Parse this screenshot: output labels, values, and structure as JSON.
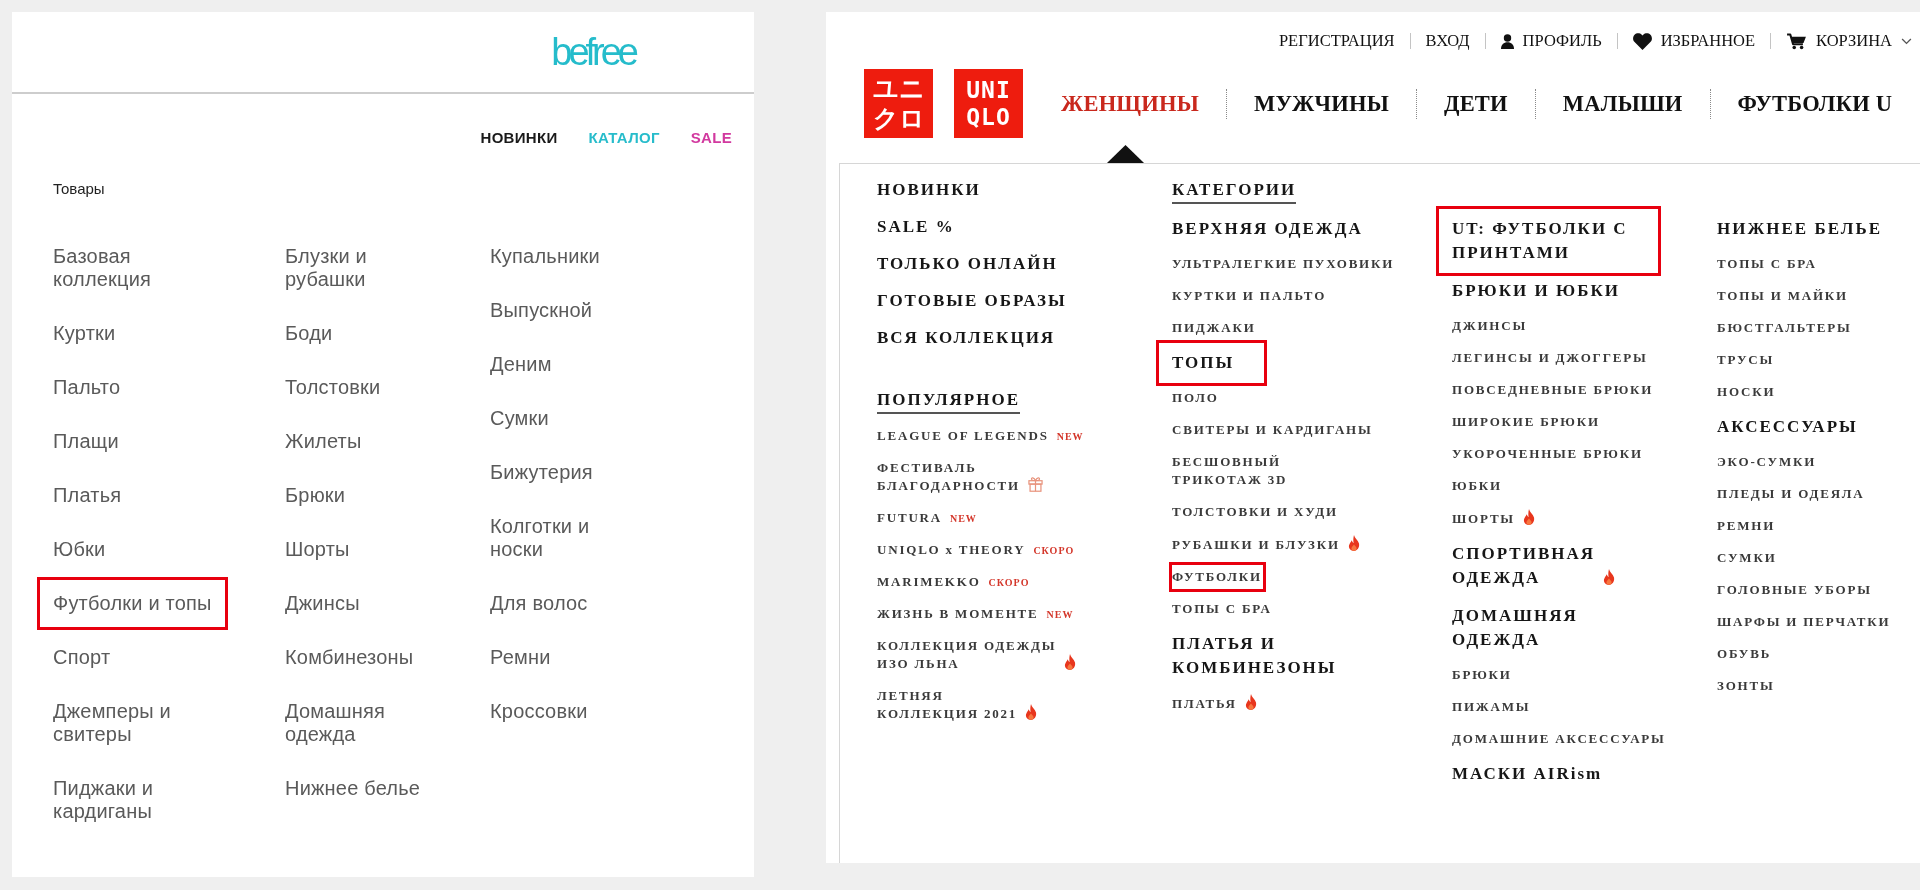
{
  "befree": {
    "logo": "befree",
    "nav": [
      {
        "label": "НОВИНКИ",
        "color": "#1a1a1a"
      },
      {
        "label": "КАТАЛОГ",
        "color": "#27bccb"
      },
      {
        "label": "SALE",
        "color": "#d2399f"
      }
    ],
    "section_title": "Товары",
    "columns": [
      [
        {
          "label": "Базовая\nколлекция",
          "highlighted": false
        },
        {
          "label": "Куртки",
          "highlighted": false
        },
        {
          "label": "Пальто",
          "highlighted": false
        },
        {
          "label": "Плащи",
          "highlighted": false
        },
        {
          "label": "Платья",
          "highlighted": false
        },
        {
          "label": "Юбки",
          "highlighted": false
        },
        {
          "label": "Футболки и топы",
          "highlighted": true
        },
        {
          "label": "Спорт",
          "highlighted": false
        },
        {
          "label": "Джемперы и\nсвитеры",
          "highlighted": false
        },
        {
          "label": "Пиджаки и\nкардиганы",
          "highlighted": false
        }
      ],
      [
        {
          "label": "Блузки и\nрубашки",
          "highlighted": false
        },
        {
          "label": "Боди",
          "highlighted": false
        },
        {
          "label": "Толстовки",
          "highlighted": false
        },
        {
          "label": "Жилеты",
          "highlighted": false
        },
        {
          "label": "Брюки",
          "highlighted": false
        },
        {
          "label": "Шорты",
          "highlighted": false
        },
        {
          "label": "Джинсы",
          "highlighted": false
        },
        {
          "label": "Комбинезоны",
          "highlighted": false
        },
        {
          "label": "Домашняя\nодежда",
          "highlighted": false
        },
        {
          "label": "Нижнее белье",
          "highlighted": false
        }
      ],
      [
        {
          "label": "Купальники",
          "highlighted": false
        },
        {
          "label": "Выпускной",
          "highlighted": false
        },
        {
          "label": "Деним",
          "highlighted": false
        },
        {
          "label": "Сумки",
          "highlighted": false
        },
        {
          "label": "Бижутерия",
          "highlighted": false
        },
        {
          "label": "Колготки и\nноски",
          "highlighted": false
        },
        {
          "label": "Для волос",
          "highlighted": false
        },
        {
          "label": "Ремни",
          "highlighted": false
        },
        {
          "label": "Кроссовки",
          "highlighted": false
        }
      ]
    ]
  },
  "uniqlo": {
    "account_links": [
      {
        "label": "РЕГИСТРАЦИЯ",
        "kind": "text",
        "dropdown": false
      },
      {
        "label": "ВХОД",
        "kind": "text",
        "dropdown": false
      },
      {
        "label": "ПРОФИЛЬ",
        "kind": "profile",
        "dropdown": false
      },
      {
        "label": "ИЗБРАННОЕ",
        "kind": "favorites",
        "dropdown": false
      },
      {
        "label": "КОРЗИНА",
        "kind": "cart",
        "dropdown": true
      }
    ],
    "logo": {
      "katakana": [
        "ユニ",
        "クロ"
      ],
      "latin": [
        "UNI",
        "QLO"
      ]
    },
    "nav": [
      {
        "label": "ЖЕНЩИНЫ",
        "selected": true
      },
      {
        "label": "МУЖЧИНЫ",
        "selected": false
      },
      {
        "label": "ДЕТИ",
        "selected": false
      },
      {
        "label": "МАЛЫШИ",
        "selected": false
      },
      {
        "label": "ФУТБОЛКИ U",
        "selected": false
      }
    ],
    "menu": {
      "featured": [
        "НОВИНКИ",
        "SALE %",
        "ТОЛЬКО ОНЛАЙН",
        "ГОТОВЫЕ ОБРАЗЫ",
        "ВСЯ КОЛЛЕКЦИЯ"
      ],
      "popular": {
        "title": "ПОПУЛЯРНОЕ",
        "items": [
          {
            "label": "LEAGUE OF LEGENDS",
            "kind": "plain",
            "tag": "NEW"
          },
          {
            "label": "ФЕСТИВАЛЬ\nБЛАГОДАРНОСТИ",
            "kind": "gift"
          },
          {
            "label": "FUTURA",
            "kind": "plain",
            "tag": "NEW"
          },
          {
            "label": "UNIQLO x THEORY",
            "kind": "plain",
            "tag": "СКОРО"
          },
          {
            "label": "MARIMEKKO",
            "kind": "plain",
            "tag": "СКОРО"
          },
          {
            "label": "ЖИЗНЬ В МОМЕНТЕ",
            "kind": "plain",
            "tag": "NEW"
          },
          {
            "label": "КОЛЛЕКЦИЯ ОДЕЖДЫ\nИЗО ЛЬНА",
            "kind": "hot"
          },
          {
            "label": "ЛЕТНЯЯ\nКОЛЛЕКЦИЯ 2021",
            "kind": "hot"
          }
        ]
      },
      "categories": {
        "title": "КАТЕГОРИИ",
        "columns": [
          [
            {
              "heading": "ВЕРХНЯЯ ОДЕЖДА",
              "kind": "plain",
              "highlighted": false,
              "items": [
                {
                  "label": "УЛЬТРАЛЕГКИЕ ПУХОВИКИ",
                  "kind": "plain",
                  "highlighted": false
                },
                {
                  "label": "КУРТКИ И ПАЛЬТО",
                  "kind": "plain",
                  "highlighted": false
                },
                {
                  "label": "ПИДЖАКИ",
                  "kind": "plain",
                  "highlighted": false
                }
              ]
            },
            {
              "heading": "ТОПЫ",
              "kind": "plain",
              "highlighted": true,
              "items": [
                {
                  "label": "ПОЛО",
                  "kind": "plain",
                  "highlighted": false
                },
                {
                  "label": "СВИТЕРЫ И КАРДИГАНЫ",
                  "kind": "plain",
                  "highlighted": false
                },
                {
                  "label": "БЕСШОВНЫЙ\nТРИКОТАЖ 3D",
                  "kind": "plain",
                  "highlighted": false
                },
                {
                  "label": "ТОЛСТОВКИ И ХУДИ",
                  "kind": "plain",
                  "highlighted": false
                },
                {
                  "label": "РУБАШКИ И БЛУЗКИ",
                  "kind": "hot",
                  "highlighted": false
                },
                {
                  "label": "ФУТБОЛКИ",
                  "kind": "plain",
                  "highlighted": true
                },
                {
                  "label": "ТОПЫ С БРА",
                  "kind": "plain",
                  "highlighted": false
                }
              ]
            },
            {
              "heading": "ПЛАТЬЯ И\nКОМБИНЕЗОНЫ",
              "kind": "plain",
              "highlighted": false,
              "items": [
                {
                  "label": "ПЛАТЬЯ",
                  "kind": "hot",
                  "highlighted": false
                }
              ]
            }
          ],
          [
            {
              "heading": "UT: ФУТБОЛКИ С\nПРИНТАМИ",
              "kind": "plain",
              "highlighted": true
            },
            {
              "heading": "БРЮКИ И ЮБКИ",
              "kind": "plain",
              "highlighted": false,
              "items": [
                {
                  "label": "ДЖИНСЫ",
                  "kind": "plain",
                  "highlighted": false
                },
                {
                  "label": "ЛЕГИНСЫ И ДЖОГГЕРЫ",
                  "kind": "plain",
                  "highlighted": false
                },
                {
                  "label": "ПОВСЕДНЕВНЫЕ БРЮКИ",
                  "kind": "plain",
                  "highlighted": false
                },
                {
                  "label": "ШИРОКИЕ БРЮКИ",
                  "kind": "plain",
                  "highlighted": false
                },
                {
                  "label": "УКОРОЧЕННЫЕ БРЮКИ",
                  "kind": "plain",
                  "highlighted": false
                },
                {
                  "label": "ЮБКИ",
                  "kind": "plain",
                  "highlighted": false
                },
                {
                  "label": "ШОРТЫ",
                  "kind": "hot",
                  "highlighted": false
                }
              ]
            },
            {
              "heading": "СПОРТИВНАЯ\nОДЕЖДА",
              "kind": "hot",
              "highlighted": false
            },
            {
              "heading": "ДОМАШНЯЯ\nОДЕЖДА",
              "kind": "plain",
              "highlighted": false,
              "items": [
                {
                  "label": "БРЮКИ",
                  "kind": "plain",
                  "highlighted": false
                },
                {
                  "label": "ПИЖАМЫ",
                  "kind": "plain",
                  "highlighted": false
                },
                {
                  "label": "ДОМАШНИЕ АКСЕССУАРЫ",
                  "kind": "plain",
                  "highlighted": false
                }
              ]
            },
            {
              "heading": "МАСКИ AIRism",
              "kind": "plain",
              "highlighted": false
            }
          ],
          [
            {
              "heading": "НИЖНЕЕ БЕЛЬЕ",
              "kind": "plain",
              "highlighted": false,
              "items": [
                {
                  "label": "ТОПЫ С БРА",
                  "kind": "plain",
                  "highlighted": false
                },
                {
                  "label": "ТОПЫ И МАЙКИ",
                  "kind": "plain",
                  "highlighted": false
                },
                {
                  "label": "БЮСТГАЛЬТЕРЫ",
                  "kind": "plain",
                  "highlighted": false
                },
                {
                  "label": "ТРУСЫ",
                  "kind": "plain",
                  "highlighted": false
                },
                {
                  "label": "НОСКИ",
                  "kind": "plain",
                  "highlighted": false
                }
              ]
            },
            {
              "heading": "АКСЕССУАРЫ",
              "kind": "plain",
              "highlighted": false,
              "items": [
                {
                  "label": "ЭКО-СУМКИ",
                  "kind": "plain",
                  "highlighted": false
                },
                {
                  "label": "ПЛЕДЫ И ОДЕЯЛА",
                  "kind": "plain",
                  "highlighted": false
                },
                {
                  "label": "РЕМНИ",
                  "kind": "plain",
                  "highlighted": false
                },
                {
                  "label": "СУМКИ",
                  "kind": "plain",
                  "highlighted": false
                },
                {
                  "label": "ГОЛОВНЫЕ УБОРЫ",
                  "kind": "plain",
                  "highlighted": false
                },
                {
                  "label": "ШАРФЫ И ПЕРЧАТКИ",
                  "kind": "plain",
                  "highlighted": false
                },
                {
                  "label": "ОБУВЬ",
                  "kind": "plain",
                  "highlighted": false
                },
                {
                  "label": "ЗОНТЫ",
                  "kind": "plain",
                  "highlighted": false
                }
              ]
            }
          ]
        ]
      }
    }
  }
}
